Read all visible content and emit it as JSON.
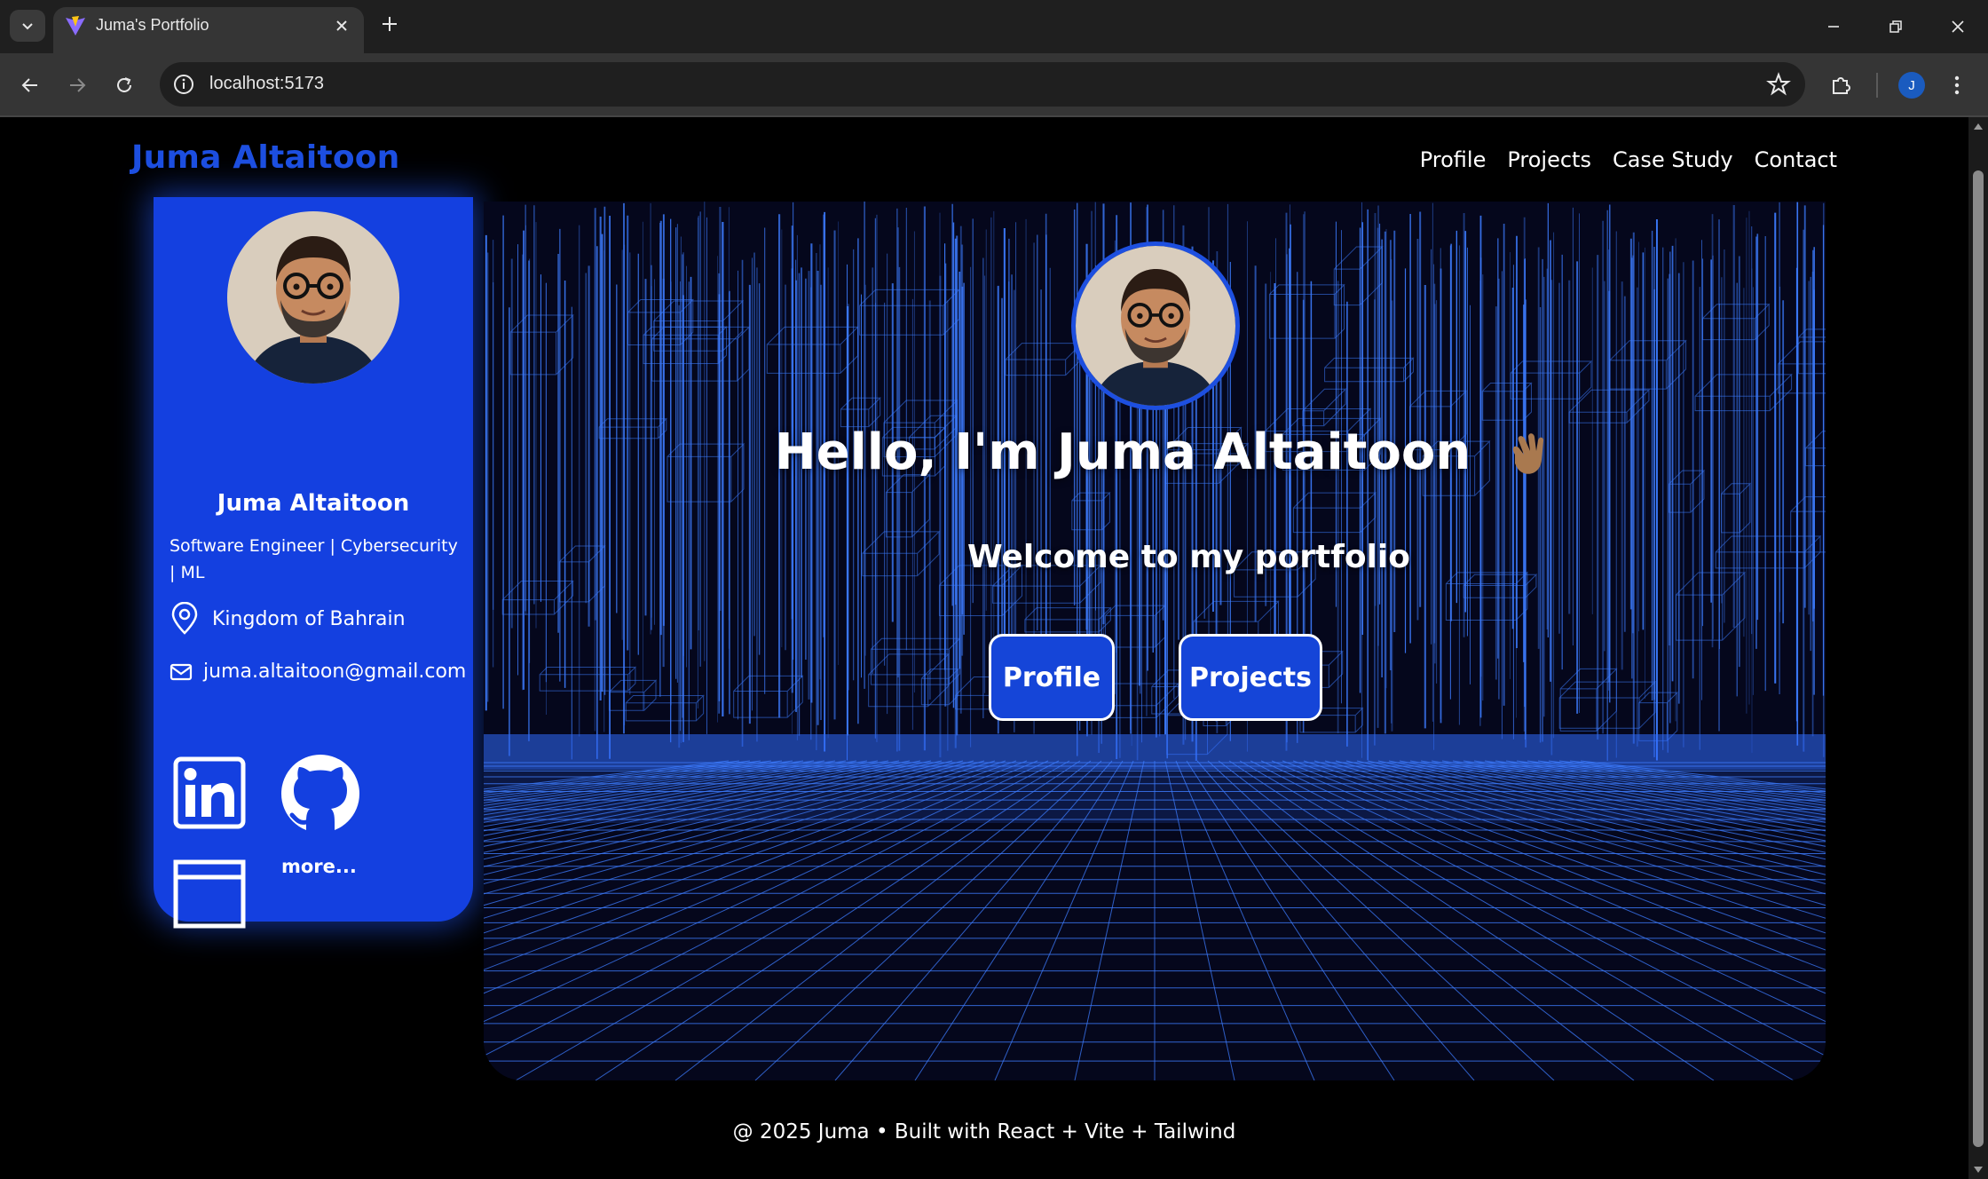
{
  "browser": {
    "tab_title": "Juma's Portfolio",
    "url": "localhost:5173",
    "profile_initial": "J"
  },
  "site": {
    "brand": "Juma Altaitoon",
    "nav": [
      {
        "label": "Profile"
      },
      {
        "label": "Projects"
      },
      {
        "label": "Case Study"
      },
      {
        "label": "Contact"
      }
    ]
  },
  "card": {
    "name": "Juma Altaitoon",
    "title": "Software Engineer | Cybersecurity | ML",
    "location": "Kingdom of Bahrain",
    "email": "juma.altaitoon@gmail.com",
    "social": [
      {
        "icon": "linkedin-icon"
      },
      {
        "icon": "github-icon"
      },
      {
        "icon": "website-icon"
      }
    ],
    "more_label": "more..."
  },
  "hero": {
    "heading": "Hello, I'm Juma Altaitoon",
    "subheading": "Welcome to my portfolio",
    "buttons": [
      {
        "label": "Profile"
      },
      {
        "label": "Projects"
      }
    ]
  },
  "footer": {
    "text": "@ 2025 Juma • Built with React + Vite + Tailwind"
  },
  "colors": {
    "brand_blue": "#1d4fe0",
    "card_blue": "#1440e0",
    "grid_blue": "#3d7cff",
    "hero_bg": "#05071c"
  }
}
